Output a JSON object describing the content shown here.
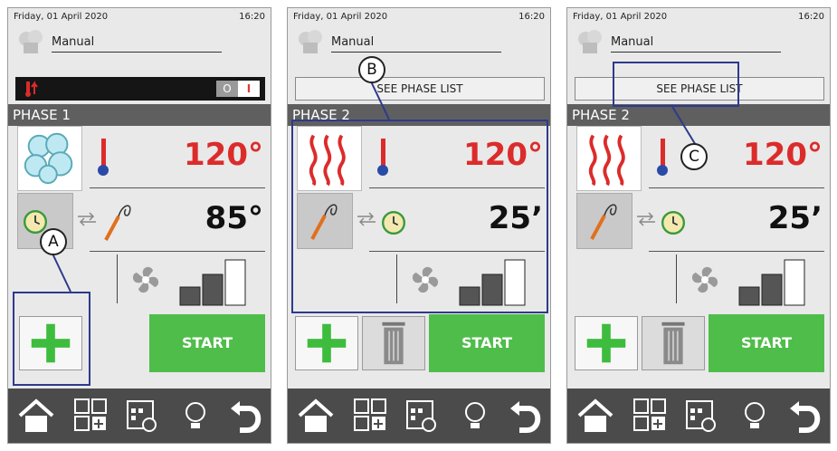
{
  "panels": [
    {
      "date": "Friday, 01 April 2020",
      "time": "16:20",
      "mode": "Manual",
      "toggle_off": "O",
      "toggle_on": "I",
      "phase": "PHASE 1",
      "temp": "120°",
      "core": "85°",
      "start": "START"
    },
    {
      "date": "Friday, 01 April 2020",
      "time": "16:20",
      "mode": "Manual",
      "see_list": "SEE PHASE LIST",
      "phase": "PHASE 2",
      "temp": "120°",
      "time_val": "25’",
      "start": "START"
    },
    {
      "date": "Friday, 01 April 2020",
      "time": "16:20",
      "mode": "Manual",
      "see_list": "SEE PHASE LIST",
      "phase": "PHASE 2",
      "temp": "120°",
      "time_val": "25’",
      "start": "START"
    }
  ],
  "callouts": {
    "a": "A",
    "b": "B",
    "c": "C"
  },
  "colors": {
    "accent_red": "#dc2b2b",
    "start_green": "#4fbd4a",
    "annotation_blue": "#2e3a8c",
    "nav_bar": "#4b4b4b"
  },
  "icons": [
    "chef-hat-icon",
    "thermometer-icon",
    "steam-icon",
    "heat-waves-icon",
    "probe-icon",
    "clock-icon",
    "swap-arrows-icon",
    "fan-icon",
    "fan-speed-bars-icon",
    "plus-icon",
    "trash-icon",
    "home-icon",
    "programs-icon",
    "calendar-icon",
    "bulb-icon",
    "back-icon"
  ]
}
